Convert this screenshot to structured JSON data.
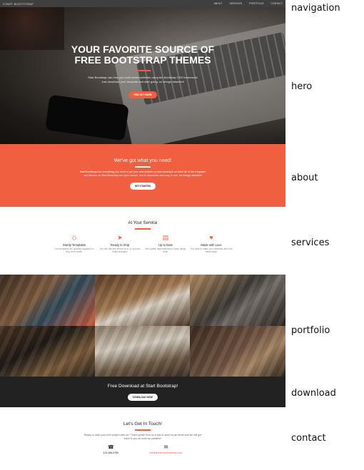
{
  "nav": {
    "brand": "START BOOTSTRAP",
    "links": [
      "ABOUT",
      "SERVICES",
      "PORTFOLIO",
      "CONTACT"
    ]
  },
  "hero": {
    "title": "YOUR FAVORITE SOURCE OF FREE BOOTSTRAP THEMES",
    "text": "Start Bootstrap can help you build better websites using the Bootstrap CSS framework! Just download your template and start going, no strings attached!",
    "button": "FIND OUT MORE"
  },
  "about": {
    "title": "We've got what you need!",
    "text": "Start Bootstrap has everything you need to get your new website up and running in no time! All of the templates and themes on Start Bootstrap are open source, free to download, and easy to use. No strings attached!",
    "button": "GET STARTED"
  },
  "services": {
    "title": "At Your Service",
    "items": [
      {
        "icon": "diamond-icon",
        "title": "Sturdy Templates",
        "text": "Our templates are updated regularly so they don't break."
      },
      {
        "icon": "paper-plane-icon",
        "title": "Ready to Ship",
        "text": "You can use this theme as is, or you can make changes!"
      },
      {
        "icon": "newspaper-icon",
        "title": "Up to Date",
        "text": "We update dependencies to keep things fresh."
      },
      {
        "icon": "heart-icon",
        "title": "Made with Love",
        "text": "You have to make your websites with love these days!"
      }
    ]
  },
  "download": {
    "title": "Free Download at Start Bootstrap!",
    "button": "DOWNLOAD NOW!"
  },
  "contact": {
    "title": "Let's Get In Touch!",
    "text": "Ready to start your next project with us? That's great! Give us a call or send us an email and we will get back to you as soon as possible!",
    "phone": "123-456-6789",
    "email": "feedback@startbootstrap.com"
  },
  "section_labels": {
    "navigation": "navigation",
    "hero": "hero",
    "about": "about",
    "services": "services",
    "portfolio": "portfolio",
    "download": "download",
    "contact": "contact"
  },
  "colors": {
    "accent": "#f05f40",
    "dark": "#222222",
    "nav": "#3f3f3f"
  }
}
